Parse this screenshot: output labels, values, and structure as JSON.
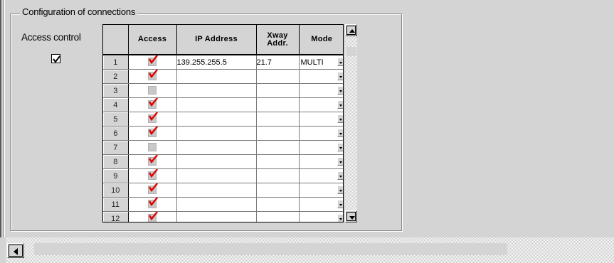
{
  "group": {
    "title": "Configuration of connections"
  },
  "access_control": {
    "label": "Access control",
    "checked": true
  },
  "table": {
    "columns": [
      "",
      "Access",
      "IP Address",
      "Xway Addr.",
      "Mode"
    ],
    "xway_header_line1": "Xway",
    "xway_header_line2": "Addr.",
    "rows": [
      {
        "num": "1",
        "access": true,
        "ip": "139.255.255.5",
        "xway": "21.7",
        "mode": "MULTI"
      },
      {
        "num": "2",
        "access": true,
        "ip": "",
        "xway": "",
        "mode": ""
      },
      {
        "num": "3",
        "access": false,
        "ip": "",
        "xway": "",
        "mode": ""
      },
      {
        "num": "4",
        "access": true,
        "ip": "",
        "xway": "",
        "mode": ""
      },
      {
        "num": "5",
        "access": true,
        "ip": "",
        "xway": "",
        "mode": ""
      },
      {
        "num": "6",
        "access": true,
        "ip": "",
        "xway": "",
        "mode": ""
      },
      {
        "num": "7",
        "access": false,
        "ip": "",
        "xway": "",
        "mode": ""
      },
      {
        "num": "8",
        "access": true,
        "ip": "",
        "xway": "",
        "mode": ""
      },
      {
        "num": "9",
        "access": true,
        "ip": "",
        "xway": "",
        "mode": ""
      },
      {
        "num": "10",
        "access": true,
        "ip": "",
        "xway": "",
        "mode": ""
      },
      {
        "num": "11",
        "access": true,
        "ip": "",
        "xway": "",
        "mode": ""
      },
      {
        "num": "12",
        "access": true,
        "ip": "",
        "xway": "",
        "mode": ""
      }
    ]
  },
  "icons": {
    "scroll_up": "scroll-up-arrow-icon",
    "scroll_down": "scroll-down-arrow-icon",
    "scroll_left": "scroll-left-arrow-icon",
    "check_red": "red-checkmark-icon",
    "dropdown": "dropdown-arrow-icon"
  },
  "colors": {
    "background": "#d4d4d4",
    "check_red": "#e00000",
    "grid_bg": "#ffffff"
  }
}
